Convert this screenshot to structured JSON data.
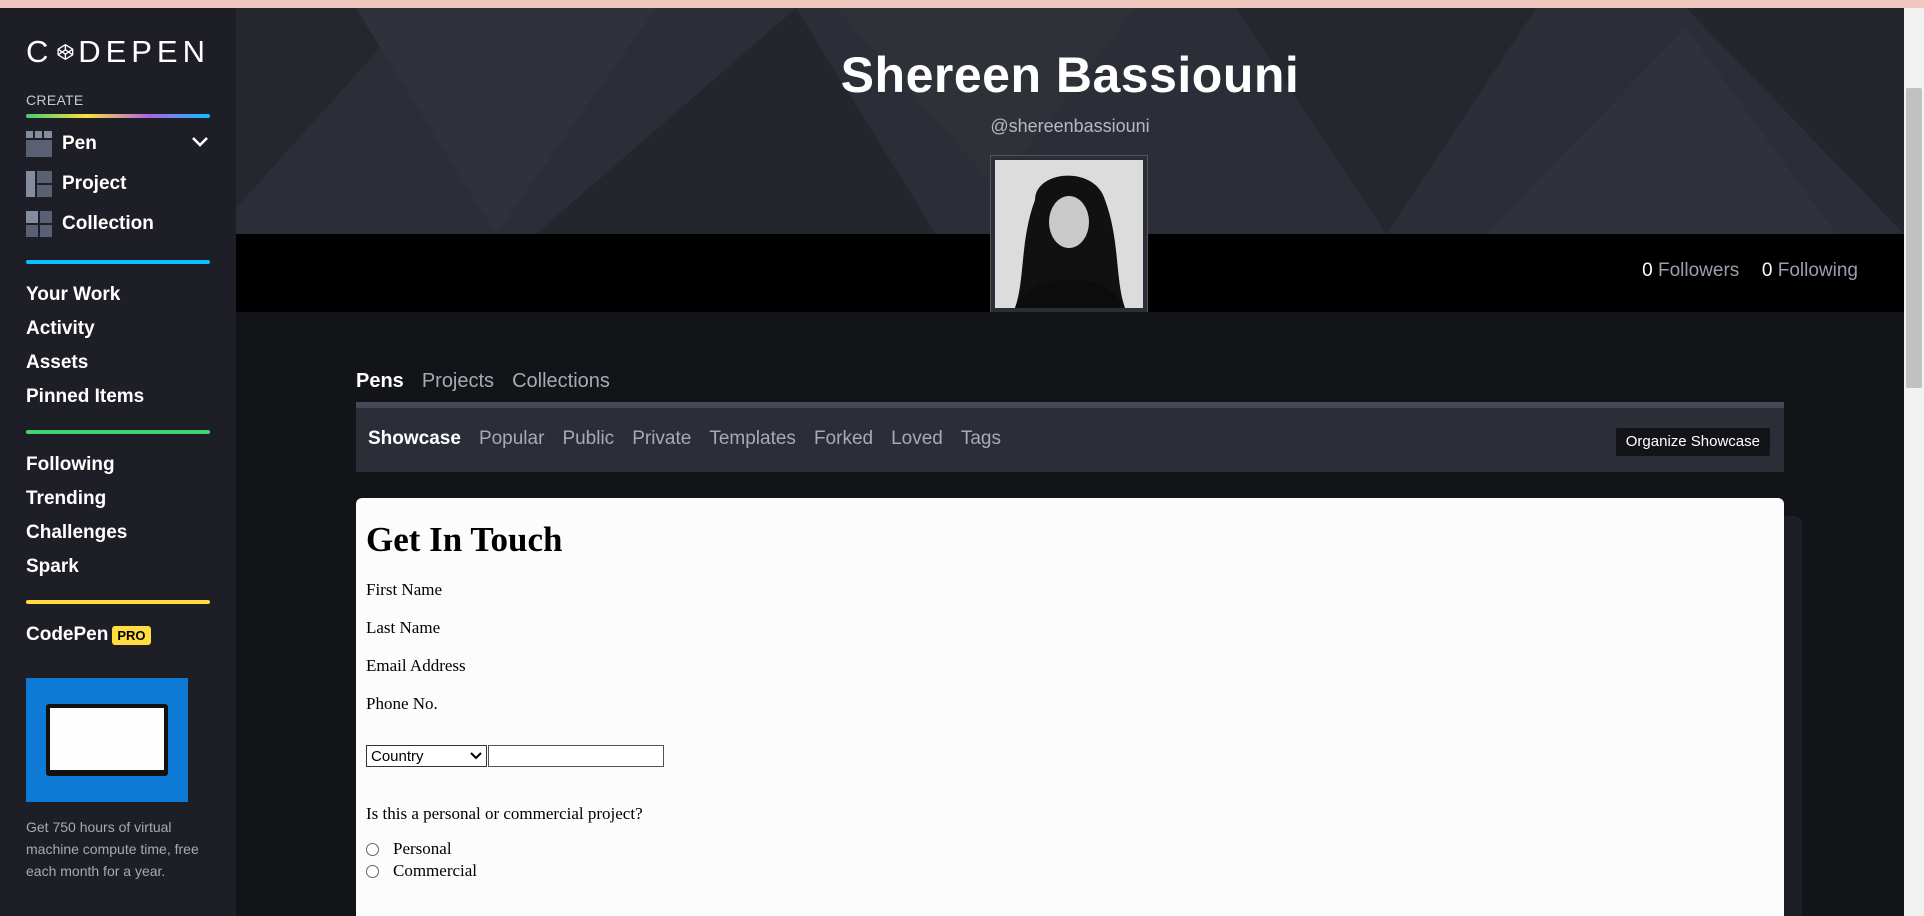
{
  "sidebar": {
    "logo_text_left": "C",
    "logo_text_right": "DEPEN",
    "create_label": "CREATE",
    "create_items": [
      {
        "label": "Pen",
        "icon": "pen-grid-icon"
      },
      {
        "label": "Project",
        "icon": "project-layout-icon"
      },
      {
        "label": "Collection",
        "icon": "collection-grid-icon"
      }
    ],
    "nav_group_1": [
      "Your Work",
      "Activity",
      "Assets",
      "Pinned Items"
    ],
    "nav_group_2": [
      "Following",
      "Trending",
      "Challenges",
      "Spark"
    ],
    "codepen_label": "CodePen",
    "pro_badge": "PRO",
    "promo_text": "Get 750 hours of virtual machine compute time, free each month for a year."
  },
  "profile": {
    "name": "Shereen Bassiouni",
    "handle": "@shereenbassiouni",
    "followers_count": "0",
    "followers_label": "Followers",
    "following_count": "0",
    "following_label": "Following"
  },
  "tabs": [
    "Pens",
    "Projects",
    "Collections"
  ],
  "subtabs": [
    "Showcase",
    "Popular",
    "Public",
    "Private",
    "Templates",
    "Forked",
    "Loved",
    "Tags"
  ],
  "organize_button": "Organize Showcase",
  "preview": {
    "title": "Get In Touch",
    "fields": [
      "First Name",
      "Last Name",
      "Email Address",
      "Phone No."
    ],
    "country_select": "Country",
    "question": "Is this a personal or commercial project?",
    "options": [
      "Personal",
      "Commercial"
    ]
  },
  "colors": {
    "sidebar_bg": "#1e1f26",
    "header_bg": "#2c2e37",
    "page_bg": "#131417",
    "accent_blue": "#0ebeff",
    "accent_green": "#47cf73",
    "accent_yellow": "#ffdd40"
  }
}
